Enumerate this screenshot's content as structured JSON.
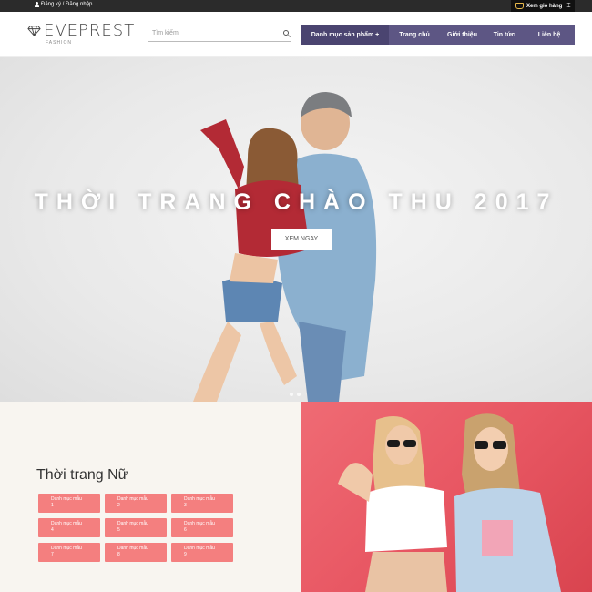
{
  "topbar": {
    "auth_text": "Đăng ký / Đăng nhập",
    "cart_label": "Xem giỏ hàng"
  },
  "header": {
    "brand": "EVEPREST",
    "tagline": "FASHION",
    "search_placeholder": "Tìm kiếm"
  },
  "nav": {
    "items": [
      {
        "label": "Danh mục sản phẩm +"
      },
      {
        "label": "Trang chủ"
      },
      {
        "label": "Giới thiệu"
      },
      {
        "label": "Tin tức"
      },
      {
        "label": "Liên hệ"
      }
    ]
  },
  "hero": {
    "title": "THỜI TRANG CHÀO THU 2017",
    "button": "XEM NGAY"
  },
  "category": {
    "title": "Thời trang Nữ",
    "tiles": [
      {
        "label": "Danh mục mẫu",
        "num": "1"
      },
      {
        "label": "Danh mục mẫu",
        "num": "2"
      },
      {
        "label": "Danh mục mẫu",
        "num": "3"
      },
      {
        "label": "Danh mục mẫu",
        "num": "4"
      },
      {
        "label": "Danh mục mẫu",
        "num": "5"
      },
      {
        "label": "Danh mục mẫu",
        "num": "6"
      },
      {
        "label": "Danh mục mẫu",
        "num": "7"
      },
      {
        "label": "Danh mục mẫu",
        "num": "8"
      },
      {
        "label": "Danh mục mẫu",
        "num": "9"
      }
    ]
  },
  "colors": {
    "nav_bg": "#5d5684",
    "nav_active": "#4a4470",
    "tile_bg": "#f47f7f",
    "promo_bg": "#e85763"
  }
}
